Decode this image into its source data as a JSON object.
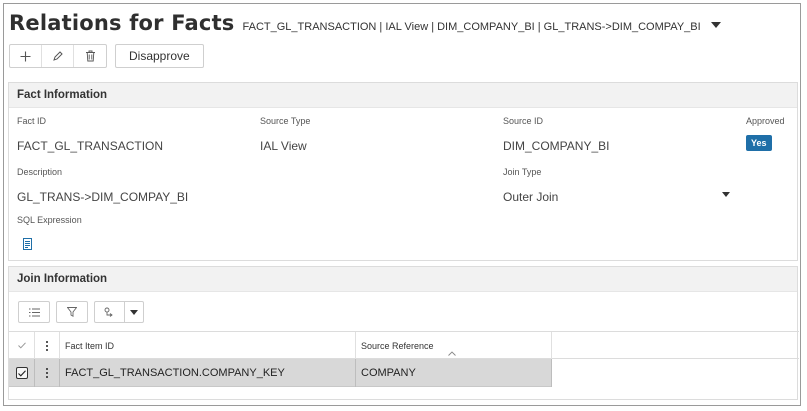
{
  "header": {
    "title": "Relations for Facts",
    "breadcrumb": "FACT_GL_TRANSACTION | IAL View | DIM_COMPANY_BI | GL_TRANS->DIM_COMPAY_BI"
  },
  "toolbar": {
    "add_icon": "plus-icon",
    "edit_icon": "pencil-icon",
    "delete_icon": "trash-icon",
    "disapprove_label": "Disapprove"
  },
  "fact_panel": {
    "heading": "Fact Information",
    "fact_id_label": "Fact ID",
    "fact_id_value": "FACT_GL_TRANSACTION",
    "source_type_label": "Source Type",
    "source_type_value": "IAL View",
    "source_id_label": "Source ID",
    "source_id_value": "DIM_COMPANY_BI",
    "approved_label": "Approved",
    "approved_value": "Yes",
    "description_label": "Description",
    "description_value": "GL_TRANS->DIM_COMPAY_BI",
    "join_type_label": "Join Type",
    "join_type_value": "Outer Join",
    "sql_label": "SQL Expression"
  },
  "join_panel": {
    "heading": "Join Information",
    "columns": [
      "Fact Item ID",
      "Source Reference"
    ],
    "rows": [
      {
        "fact_item_id": "FACT_GL_TRANSACTION.COMPANY_KEY",
        "source_reference": "COMPANY"
      }
    ]
  },
  "colors": {
    "accent": "#1f6fa8",
    "selected_row": "#d8d8d8",
    "panel_header": "#f2f2f2"
  }
}
